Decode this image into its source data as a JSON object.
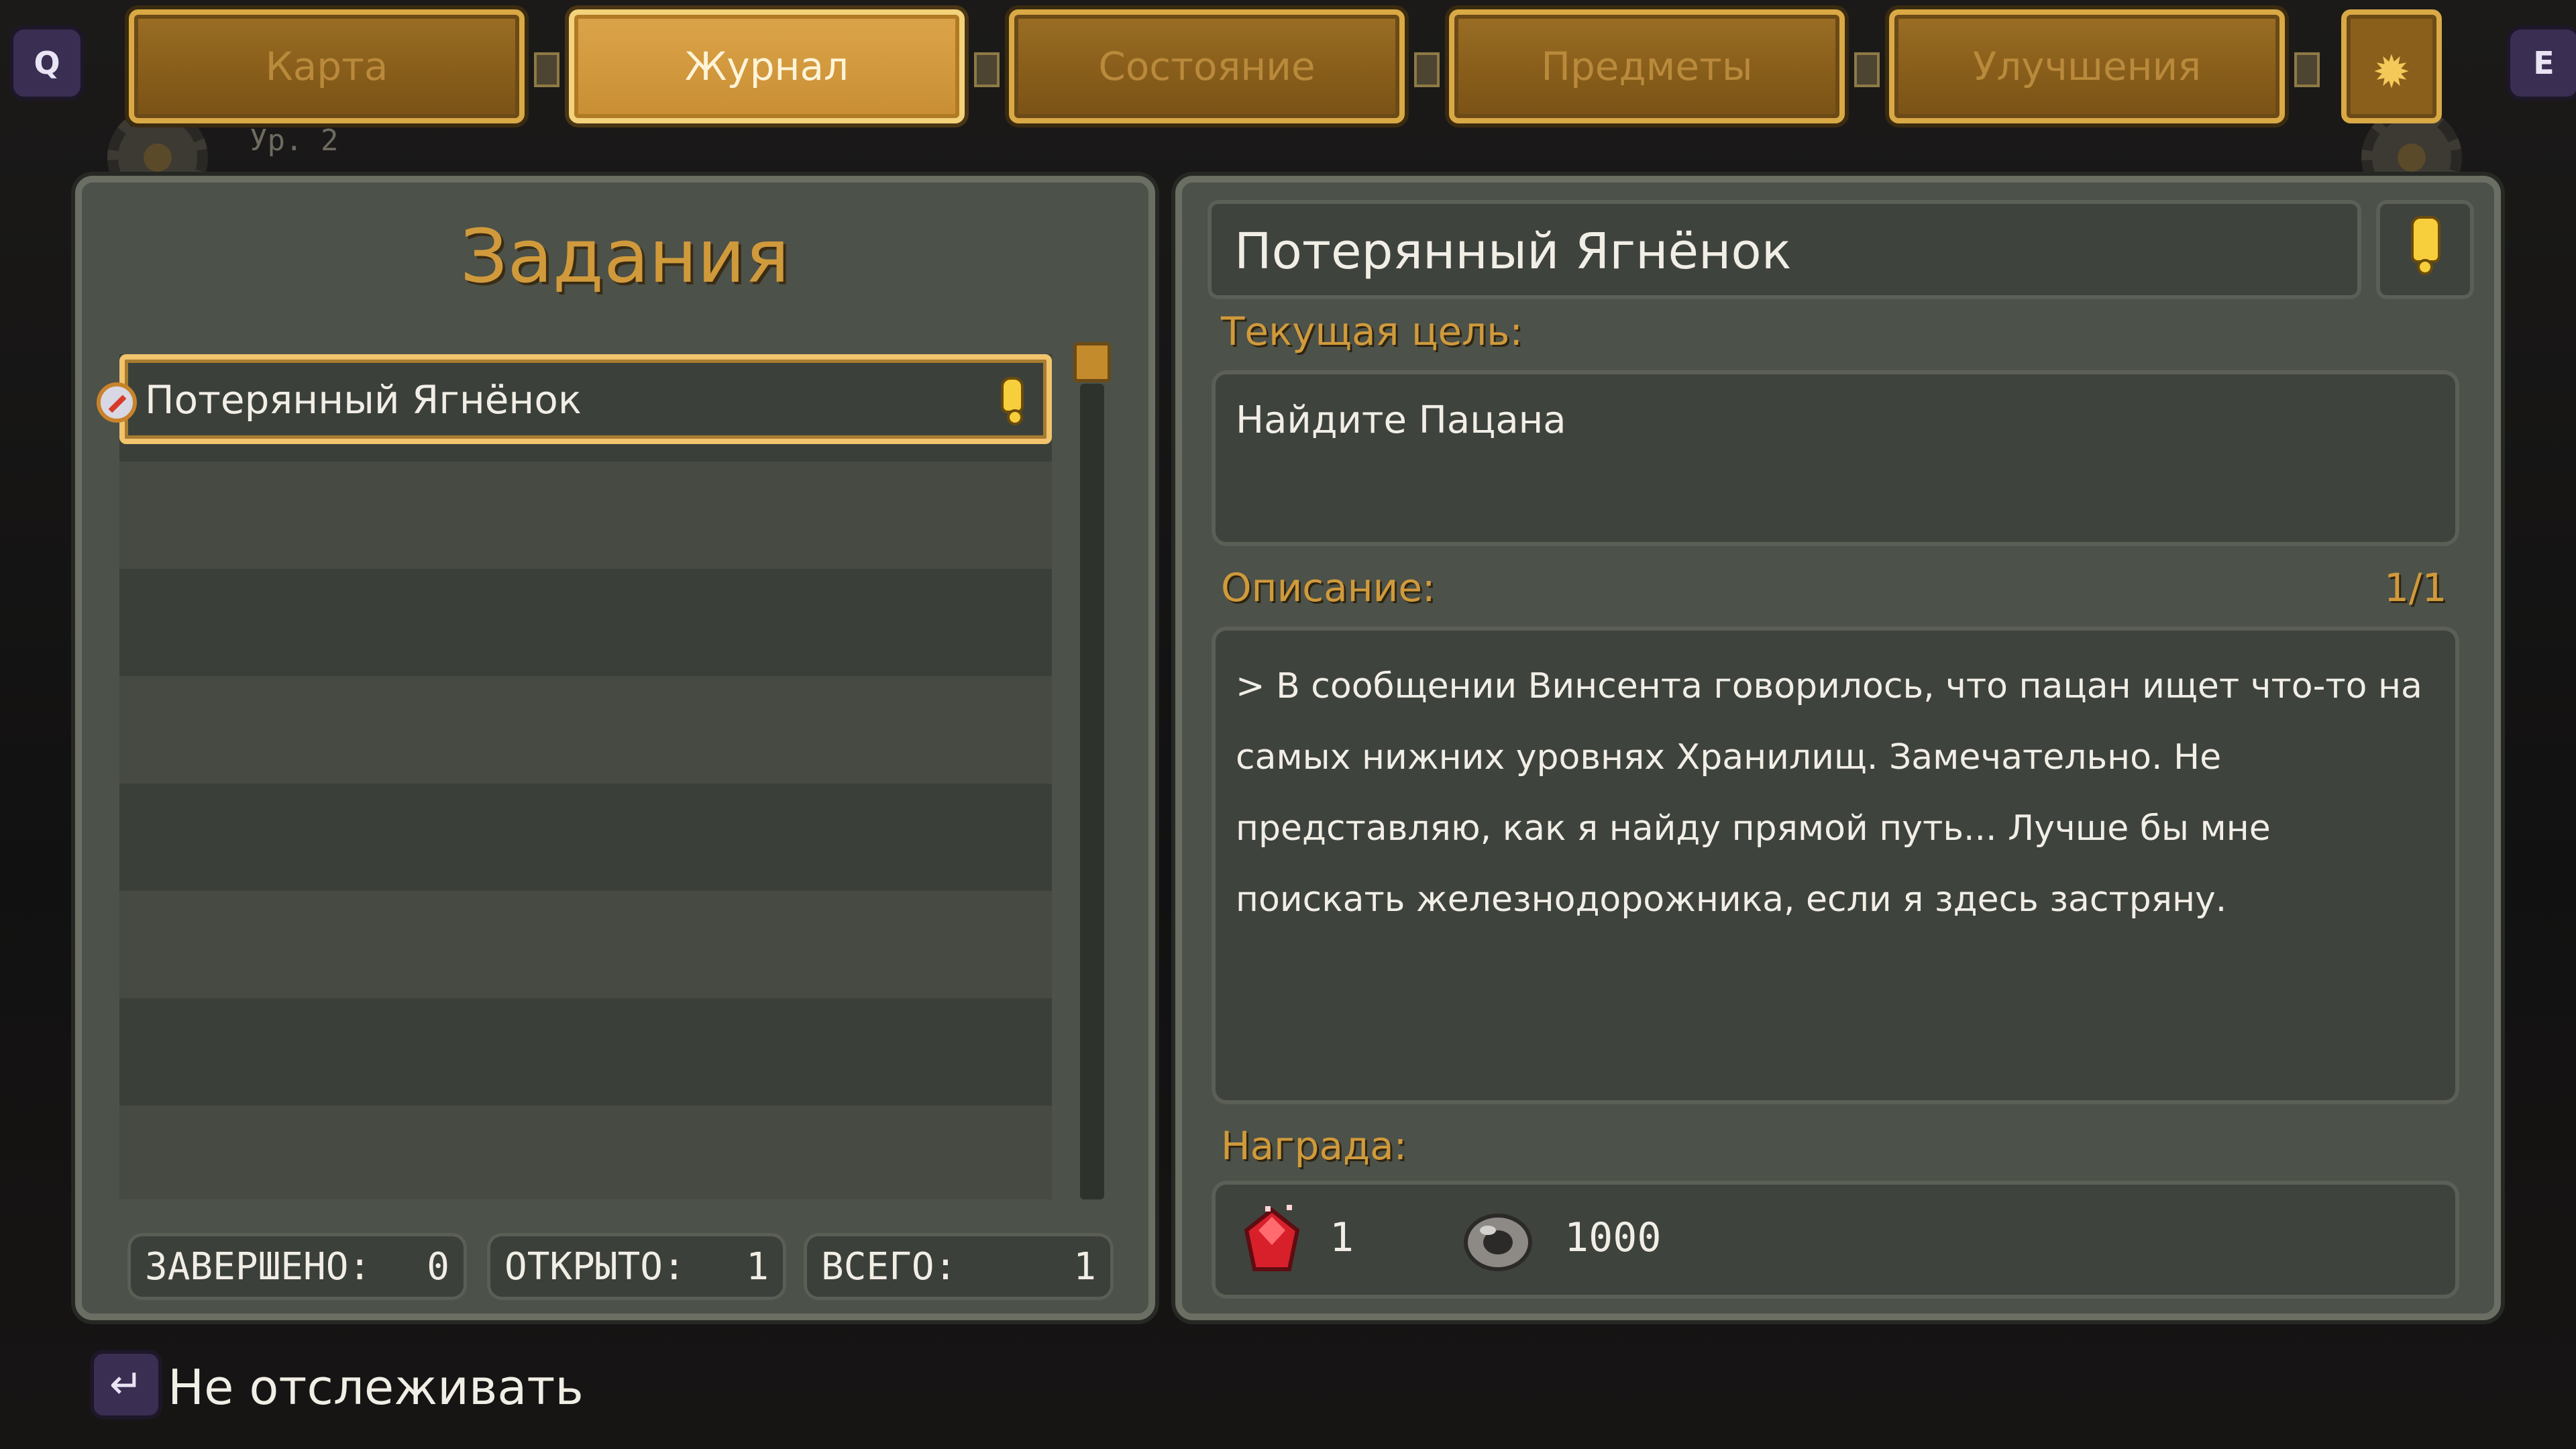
{
  "top_bar": {
    "left_key": "Q",
    "right_key": "E",
    "tabs": [
      {
        "label": "Карта",
        "active": false
      },
      {
        "label": "Журнал",
        "active": true
      },
      {
        "label": "Состояние",
        "active": false
      },
      {
        "label": "Предметы",
        "active": false
      },
      {
        "label": "Улучшения",
        "active": false
      }
    ],
    "settings_icon": "gear-icon",
    "level_label": "Ур. 2"
  },
  "quests_panel": {
    "title": "Задания",
    "items": [
      {
        "name": "Потерянный Ягнёнок",
        "icon": "compass-icon",
        "tracked": true
      }
    ],
    "stats": {
      "completed_label": "ЗАВЕРШЕНО:",
      "completed_value": "0",
      "open_label": "ОТКРЫТО:",
      "open_value": "1",
      "total_label": "ВСЕГО:",
      "total_value": "1"
    }
  },
  "details": {
    "title": "Потерянный Ягнёнок",
    "goal_label": "Текущая цель:",
    "goal": "Найдите Пацана",
    "description_label": "Описание:",
    "page": "1/1",
    "description": "> В сообщении Винсента говорилось, что пацан ищет что-то на самых нижних уровнях Хранилищ. Замечательно. Не представляю, как я найду прямой путь... Лучше бы мне поискать железнодорожника, если я здесь застряну.",
    "reward_label": "Награда:",
    "rewards": [
      {
        "icon": "ruby-gem-icon",
        "amount": "1"
      },
      {
        "icon": "scrap-metal-icon",
        "amount": "1000"
      }
    ]
  },
  "footer": {
    "key_icon": "enter-key-icon",
    "action": "Не отслеживать"
  },
  "colors": {
    "accent_gold": "#d09a3c",
    "panel": "#4c5149",
    "text": "#f1eee6"
  }
}
